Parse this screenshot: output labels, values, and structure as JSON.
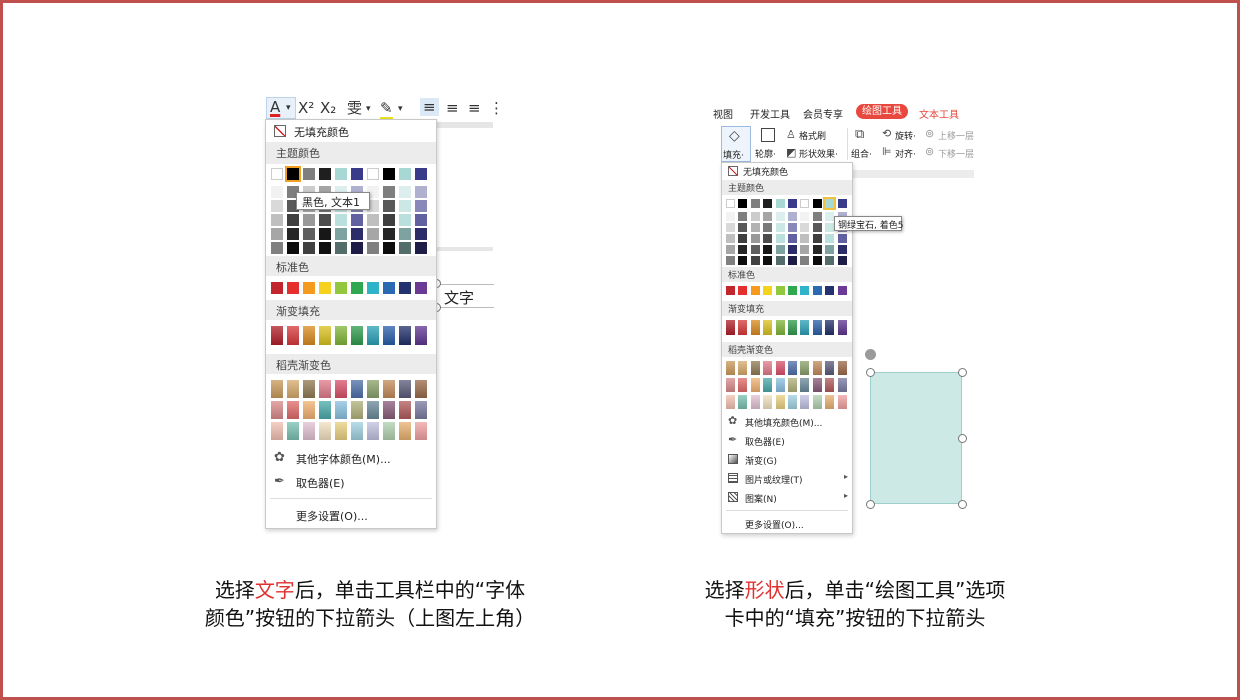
{
  "left": {
    "toolbar": {
      "font_color_icon": "A",
      "superscript_icon": "X²",
      "subscript_icon": "X₂",
      "phonetic_icon": "雯",
      "highlight_icon": "✎",
      "align_left_icon": "≡",
      "align_center_icon": "≡",
      "align_right_icon": "≡"
    },
    "menu": {
      "no_fill": "无填充颜色",
      "theme_colors_header": "主题颜色",
      "standard_colors_header": "标准色",
      "gradient_fill_header": "渐变填充",
      "shell_gradient_header": "稻壳渐变色",
      "more_font_colors": "其他字体颜色(M)...",
      "eyedropper": "取色器(E)",
      "more_settings": "更多设置(O)..."
    },
    "tooltip": "黑色, 文本1",
    "shape_text": "文字"
  },
  "right": {
    "ribbon_tabs": [
      "视图",
      "开发工具",
      "会员专享",
      "绘图工具",
      "文本工具"
    ],
    "ribbon": {
      "fill_label": "填充·",
      "outline_label": "轮廓·",
      "format_painter": "格式刷",
      "shape_effects": "形状效果·",
      "group_label": "组合·",
      "rotate_label": "旋转·",
      "align_label": "对齐·",
      "move_up": "上移一层",
      "move_down": "下移一层"
    },
    "menu": {
      "no_fill": "无填充颜色",
      "theme_colors_header": "主题颜色",
      "standard_colors_header": "标准色",
      "gradient_fill_header": "渐变填充",
      "shell_gradient_header": "稻壳渐变色",
      "more_fill_colors": "其他填充颜色(M)...",
      "eyedropper": "取色器(E)",
      "gradient": "渐变(G)",
      "picture_texture": "图片或纹理(T)",
      "pattern": "图案(N)",
      "more_settings": "更多设置(O)..."
    },
    "tooltip": "钢绿宝石, 着色5"
  },
  "captions": {
    "left_line1_a": "选择",
    "left_line1_hl": "文字",
    "left_line1_b": "后，单击工具栏中的“字体",
    "left_line2": "颜色”按钮的下拉箭头（上图左上角）",
    "right_line1_a": "选择",
    "right_line1_hl": "形状",
    "right_line1_b": "后，单击“绘图工具”选项",
    "right_line2": "卡中的“填充”按钮的下拉箭头"
  },
  "palette": {
    "theme_top": [
      "#ffffff",
      "#000000",
      "#7f7f7f",
      "#1f1f1f",
      "#a8d8d4",
      "#3a3a8a",
      "#ffffff",
      "#000000",
      "#a8d8d4",
      "#3a3a8a"
    ],
    "standard": [
      "#c0262c",
      "#e52e2e",
      "#f39a1f",
      "#f5d21d",
      "#92c83e",
      "#2fa84f",
      "#2fb3c9",
      "#2a6ab3",
      "#24336e",
      "#6b3a96"
    ],
    "gradient": [
      "#b01f2a",
      "#d7383a",
      "#d98a1f",
      "#d9c21f",
      "#7fb538",
      "#2f9b4c",
      "#2aa0b5",
      "#2a5ea8",
      "#22306a",
      "#5e3590"
    ],
    "shell_rows": [
      [
        "#c99a5b",
        "#d6a96b",
        "#8f7a52",
        "#e07a8a",
        "#d9506a",
        "#4e6fa8",
        "#8aa06a",
        "#c28a5a",
        "#5a5a7a",
        "#9a6a4a"
      ],
      [
        "#d98a8a",
        "#e06a6a",
        "#f0b070",
        "#4aaaaa",
        "#8ac0e0",
        "#b0b07a",
        "#6a8a9a",
        "#8a5a7a",
        "#b05a5a",
        "#7a7aa0"
      ],
      [
        "#f0c0b0",
        "#7ac0b0",
        "#e0c0d0",
        "#f0e0c0",
        "#e8d080",
        "#a0d0e0",
        "#c0c0e0",
        "#b0d0b0",
        "#e8b070",
        "#f0a0a0"
      ]
    ]
  }
}
